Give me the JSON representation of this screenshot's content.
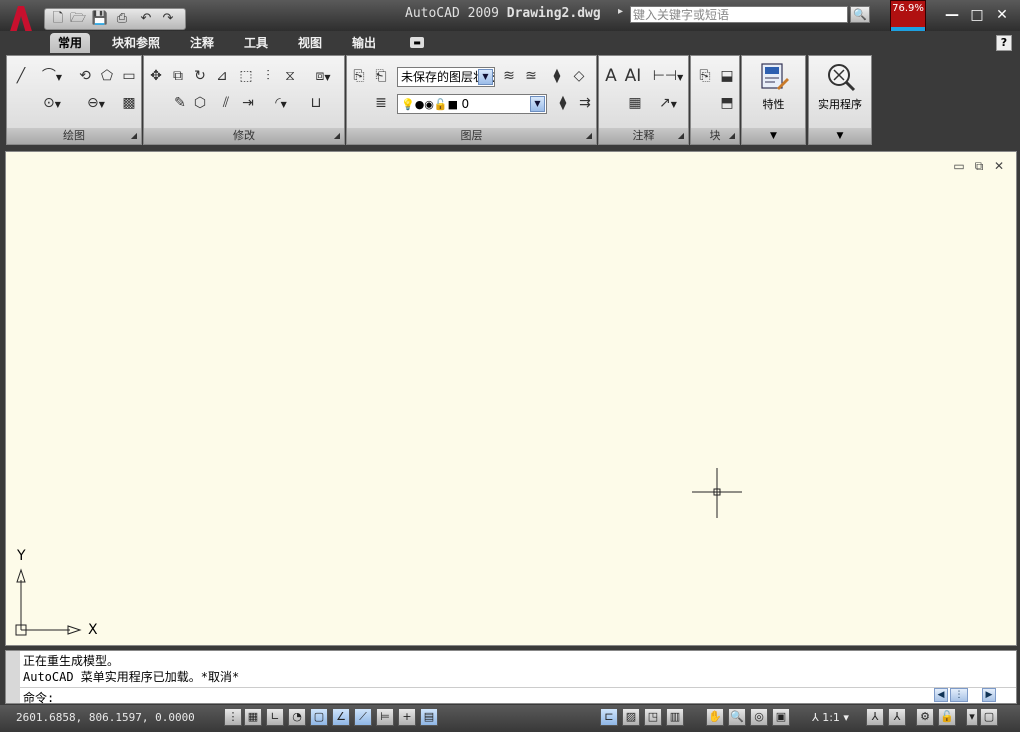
{
  "window": {
    "product": "AutoCAD 2009",
    "document": "Drawing2.dwg",
    "search_placeholder": "键入关键字或短语",
    "perf_badge": "76.9%",
    "controls": {
      "minimize": "—",
      "maximize": "□",
      "close": "✕"
    }
  },
  "quick_access": [
    "new-icon",
    "open-icon",
    "save-icon",
    "print-icon",
    "undo-icon",
    "redo-icon"
  ],
  "tabs": [
    {
      "label": "常用",
      "active": true
    },
    {
      "label": "块和参照",
      "active": false
    },
    {
      "label": "注释",
      "active": false
    },
    {
      "label": "工具",
      "active": false
    },
    {
      "label": "视图",
      "active": false
    },
    {
      "label": "输出",
      "active": false
    }
  ],
  "help_label": "?",
  "ribbon": {
    "panels": {
      "draw": "绘图",
      "modify": "修改",
      "layers": "图层",
      "annotation": "注释",
      "block": "块"
    },
    "layer_state": "未保存的图层状态",
    "current_layer": "0",
    "properties_label": "特性",
    "utilities_label": "实用程序"
  },
  "ucs": {
    "x_label": "X",
    "y_label": "Y"
  },
  "command": {
    "history": [
      "正在重生成模型。",
      "AutoCAD 菜单实用程序已加载。*取消*"
    ],
    "prompt": "命令:"
  },
  "status": {
    "coordinates": "2601.6858, 806.1597, 0.0000",
    "annotation_scale": "1:1"
  },
  "colors": {
    "canvas_bg": "#fdfbe9",
    "chrome_dark": "#3a3a3a",
    "logo_red": "#c8102e"
  }
}
